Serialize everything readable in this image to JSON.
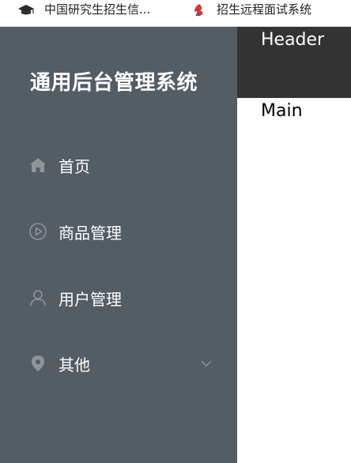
{
  "bookmarks": [
    {
      "label": "中国研究生招生信...",
      "icon": "graduation-cap-icon"
    },
    {
      "label": "招生远程面试系统",
      "icon": "flame-logo-icon"
    }
  ],
  "sidebar": {
    "title": "通用后台管理系统",
    "background": "#545c64",
    "items": [
      {
        "label": "首页",
        "icon": "home-icon"
      },
      {
        "label": "商品管理",
        "icon": "video-play-icon"
      },
      {
        "label": "用户管理",
        "icon": "user-icon"
      },
      {
        "label": "其他",
        "icon": "location-pin-icon",
        "has_submenu": true
      }
    ]
  },
  "header": {
    "text": "Header",
    "background": "#333333"
  },
  "main": {
    "text": "Main"
  }
}
